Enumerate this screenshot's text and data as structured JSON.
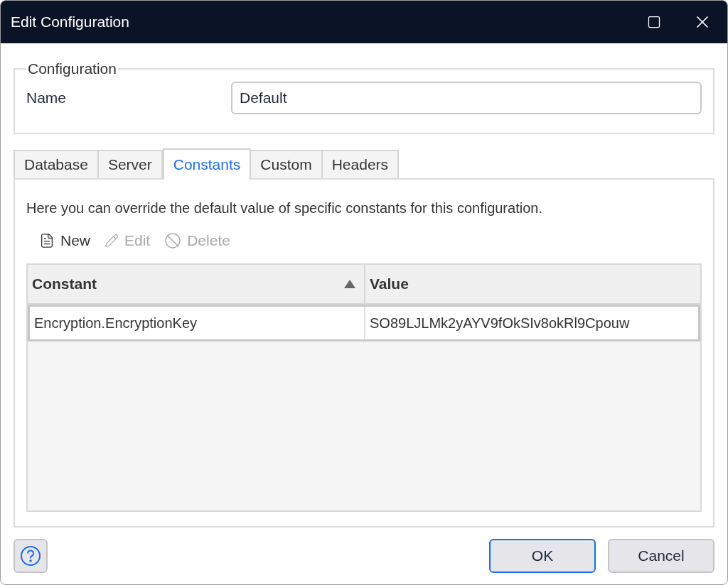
{
  "window": {
    "title": "Edit Configuration"
  },
  "configuration": {
    "legend": "Configuration",
    "name_label": "Name",
    "name_value": "Default"
  },
  "tabs": [
    {
      "label": "Database",
      "selected": false
    },
    {
      "label": "Server",
      "selected": false
    },
    {
      "label": "Constants",
      "selected": true
    },
    {
      "label": "Custom",
      "selected": false
    },
    {
      "label": "Headers",
      "selected": false
    }
  ],
  "description": "Here you can override the default value of specific constants for this configuration.",
  "toolbar": [
    {
      "kind": "new",
      "label": "New",
      "disabled": false
    },
    {
      "kind": "edit",
      "label": "Edit",
      "disabled": true
    },
    {
      "kind": "delete",
      "label": "Delete",
      "disabled": true
    }
  ],
  "table": {
    "columns": [
      {
        "label": "Constant",
        "sorted_ascending": true
      },
      {
        "label": "Value",
        "sorted_ascending": false
      }
    ],
    "rows": [
      {
        "cells": [
          "Encryption.EncryptionKey",
          "SO89LJLMk2yAYV9fOkSIv8okRl9Cpouw"
        ],
        "selected": true
      }
    ]
  },
  "buttons": [
    {
      "label": "OK",
      "default": true
    },
    {
      "label": "Cancel",
      "default": false
    }
  ]
}
